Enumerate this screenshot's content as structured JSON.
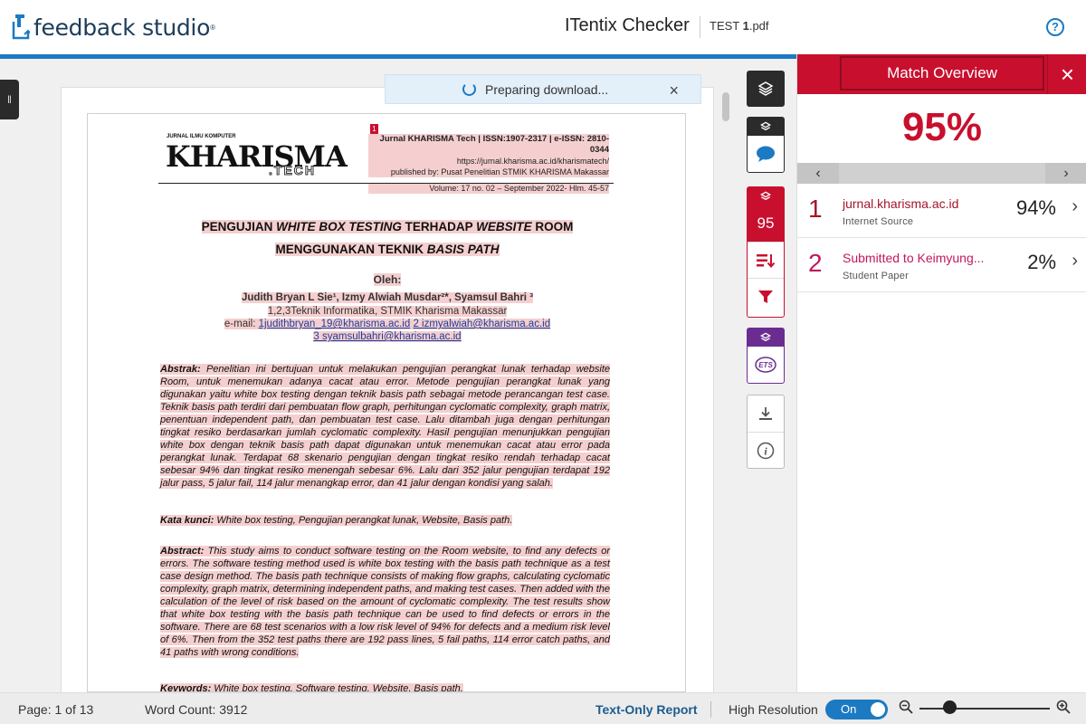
{
  "header": {
    "logo_text": "feedback studio",
    "logo_tm": "®",
    "app_title": "ITentix Checker",
    "file_prefix": "TEST ",
    "file_bold": "1",
    "file_suffix": ".pdf",
    "help": "?"
  },
  "toast": {
    "text": "Preparing download...",
    "close": "×"
  },
  "paper": {
    "logo_small": "JURNAL ILMU KOMPUTER",
    "logo_big": "KHARISMA",
    "logo_tech": ".TECH",
    "marker": "1",
    "header_lines": [
      "Jurnal KHARISMA Tech | ISSN:1907-2317 | e-ISSN: 2810-0344",
      "https://jurnal.kharisma.ac.id/kharismatech/",
      "published by: Pusat Penelitian STMIK KHARISMA Makassar",
      "Volume: 17 no. 02 – September 2022- Hlm. 45-57"
    ],
    "title_line1_a": "PENGUJIAN ",
    "title_line1_b": "WHITE BOX TESTING",
    "title_line1_c": " TERHADAP ",
    "title_line1_d": "WEBSITE",
    "title_line1_e": " ROOM",
    "title_line2_a": "MENGGUNAKAN TEKNIK ",
    "title_line2_b": "BASIS PATH",
    "oleh": "Oleh:",
    "authors": "Judith Bryan L Sie¹, Izmy Alwiah Musdar²*, Syamsul Bahri ³",
    "affiliation": "1,2,3Teknik Informatika, STMIK Kharisma Makassar",
    "email_label": "e-mail: ",
    "email1": "1judithbryan_19@kharisma.ac.id",
    "email2": "2 izmyalwiah@kharisma.ac.id",
    "email3": "3 syamsulbahri@kharisma.ac.id",
    "abstrak_label": "Abstrak:",
    "abstrak_text": " Penelitian ini bertujuan untuk melakukan pengujian perangkat lunak terhadap website Room, untuk menemukan adanya cacat atau error. Metode pengujian perangkat lunak yang digunakan yaitu white box testing dengan teknik basis path sebagai metode perancangan test case. Teknik basis path terdiri dari pembuatan flow graph, perhitungan cyclomatic complexity, graph matrix, penentuan independent path, dan pembuatan test case. Lalu ditambah juga dengan perhitungan tingkat resiko berdasarkan jumlah cyclomatic complexity. Hasil pengujian menunjukkan pengujian white box dengan teknik basis path dapat digunakan untuk menemukan cacat atau error pada perangkat lunak. Terdapat 68 skenario pengujian dengan tingkat resiko rendah terhadap cacat sebesar 94% dan tingkat resiko menengah sebesar 6%. Lalu dari 352 jalur pengujian terdapat 192 jalur pass, 5 jalur fail, 114 jalur menangkap error, dan 41 jalur dengan kondisi yang salah.",
    "kata_label": "Kata kunci:",
    "kata_text": " White box testing, Pengujian perangkat lunak, Website, Basis path.",
    "abstract_label": "Abstract:",
    "abstract_text": " This study aims to conduct software testing on the Room website, to find any defects or errors. The software testing method used is white box testing with the basis path technique as a test case design method. The basis path technique consists of making flow graphs, calculating cyclomatic complexity, graph matrix, determining independent paths, and making test cases. Then added with the calculation of the level of risk based on the amount of cyclomatic complexity. The test results show that white box testing with the basis path technique can be used to find defects or errors in the software. There are 68 test scenarios with a low risk level of 94% for defects and a medium risk level of 6%. Then from the 352 test paths there are 192 pass lines, 5 fail paths, 114 error catch paths, and 41 paths with wrong conditions.",
    "keywords_label": "Keywords:",
    "keywords_text": " White box testing, Software testing, Website, Basis path."
  },
  "rail": {
    "match_count": "95"
  },
  "panel": {
    "title": "Match Overview",
    "close": "×",
    "percent": "95%",
    "prev": "‹",
    "next": "›",
    "matches": [
      {
        "num": "1",
        "source": "jurnal.kharisma.ac.id",
        "type": "Internet Source",
        "pct": "94%",
        "color": "#a3162a"
      },
      {
        "num": "2",
        "source": "Submitted to Keimyung...",
        "type": "Student Paper",
        "pct": "2%",
        "color": "#c2185b"
      }
    ],
    "arrow": "›"
  },
  "footer": {
    "page": "Page: 1 of 13",
    "words": "Word Count: 3912",
    "text_only": "Text-Only Report",
    "high_res": "High Resolution",
    "toggle": "On"
  },
  "colors": {
    "brand_blue": "#1c7ac2",
    "match_red": "#c8102e",
    "highlight": "#f5cfcf",
    "ets_purple": "#6b2c91"
  }
}
